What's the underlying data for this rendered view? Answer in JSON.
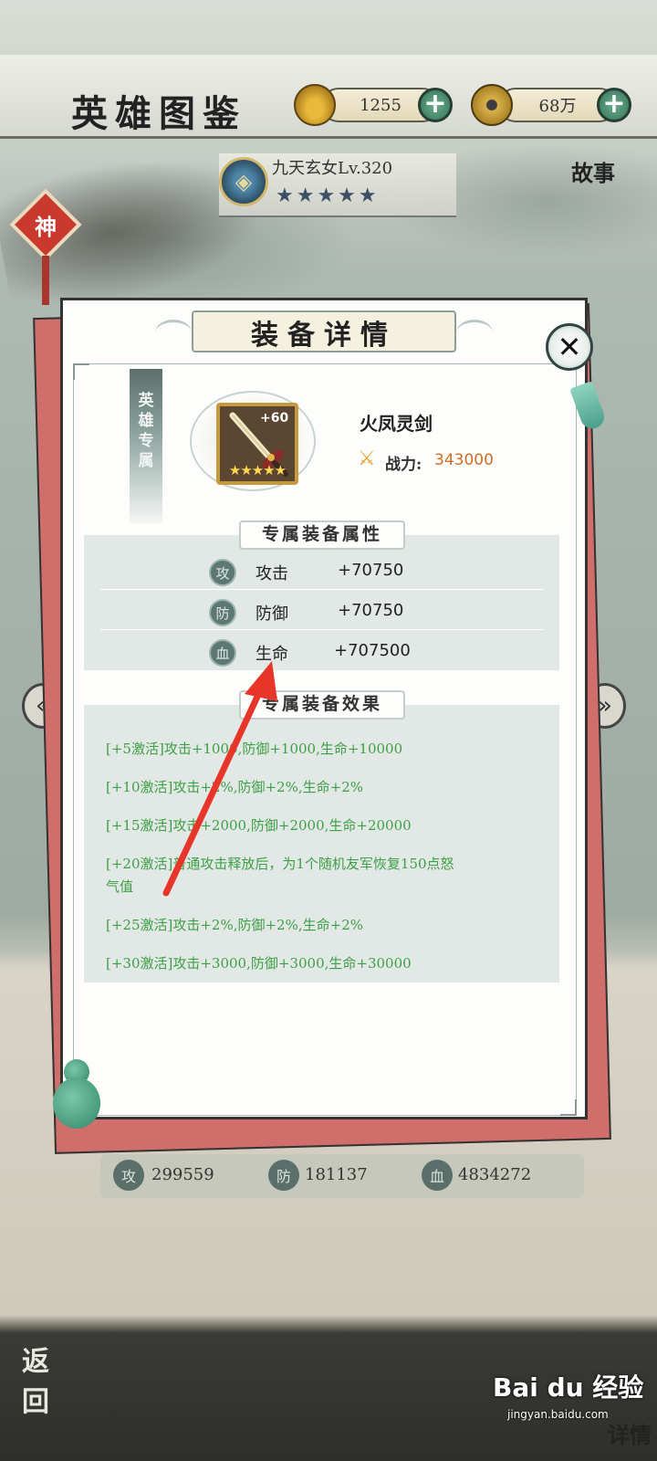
{
  "header": {
    "title": "英雄图鉴",
    "gold": {
      "icon": "gold-ingot-icon",
      "value": "1255"
    },
    "coin": {
      "icon": "copper-coin-icon",
      "value": "68万"
    }
  },
  "hero": {
    "name": "九天玄女Lv.320",
    "stars": "★★★★★",
    "story_label": "故事",
    "badge_label": "神"
  },
  "dialog": {
    "title": "装备详情",
    "tag_label": "英雄专属",
    "item": {
      "name": "火凤灵剑",
      "level": "+60",
      "stars": "★★★★★",
      "power_label": "战力:",
      "power_value": "343000"
    },
    "attributes_title": "专属装备属性",
    "attributes": [
      {
        "icon_text": "攻",
        "name": "攻击",
        "value": "+70750"
      },
      {
        "icon_text": "防",
        "name": "防御",
        "value": "+70750"
      },
      {
        "icon_text": "血",
        "name": "生命",
        "value": "+707500"
      }
    ],
    "effects_title": "专属装备效果",
    "effects": [
      "[+5激活]攻击+1000,防御+1000,生命+10000",
      "[+10激活]攻击+2%,防御+2%,生命+2%",
      "[+15激活]攻击+2000,防御+2000,生命+20000",
      "[+20激活]普通攻击释放后，为1个随机友军恢复150点怒",
      "气值",
      "[+25激活]攻击+2%,防御+2%,生命+2%",
      "[+30激活]攻击+3000,防御+3000,生命+30000"
    ]
  },
  "footer_stats": [
    {
      "icon_text": "攻",
      "value": "299559"
    },
    {
      "icon_text": "防",
      "value": "181137"
    },
    {
      "icon_text": "血",
      "value": "4834272"
    }
  ],
  "bottom": {
    "back_label": "返回",
    "detail_label": "详情"
  },
  "watermark": {
    "main": "Bai du 经验",
    "sub": "jingyan.baidu.com"
  },
  "colors": {
    "effect_text": "#3ea046",
    "power_value": "#d06f24",
    "annotation_arrow": "#e8352a"
  }
}
